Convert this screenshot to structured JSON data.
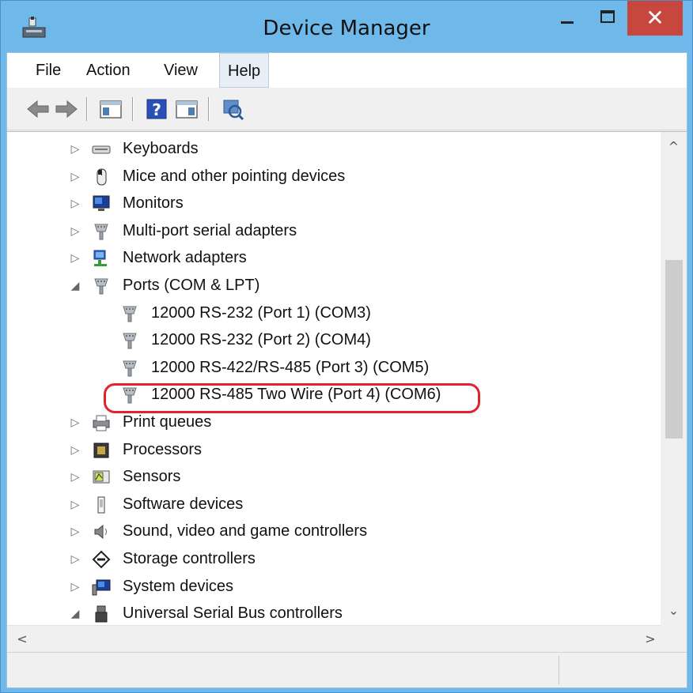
{
  "window": {
    "title": "Device Manager",
    "close_glyph": "✕"
  },
  "menu": {
    "items": [
      {
        "label": "File"
      },
      {
        "label": "Action"
      },
      {
        "label": "View"
      },
      {
        "label": "Help"
      }
    ]
  },
  "toolbar": {
    "buttons": [
      "back-arrow-icon",
      "forward-arrow-icon",
      "show-hide-tree-icon",
      "help-icon",
      "properties-icon",
      "scan-hardware-icon"
    ]
  },
  "tree": {
    "rows": [
      {
        "label": "Keyboards",
        "expander": "▷",
        "icon": "keyboard-icon"
      },
      {
        "label": "Mice and other pointing devices",
        "expander": "▷",
        "icon": "mouse-icon"
      },
      {
        "label": "Monitors",
        "expander": "▷",
        "icon": "monitor-icon"
      },
      {
        "label": "Multi-port serial adapters",
        "expander": "▷",
        "icon": "serial-port-icon"
      },
      {
        "label": "Network adapters",
        "expander": "▷",
        "icon": "network-icon"
      },
      {
        "label": "Ports (COM & LPT)",
        "expander": "◢",
        "icon": "serial-port-icon"
      },
      {
        "label": "12000 RS-232 (Port 1) (COM3)",
        "expander": "",
        "icon": "serial-port-icon"
      },
      {
        "label": "12000 RS-232 (Port 2) (COM4)",
        "expander": "",
        "icon": "serial-port-icon"
      },
      {
        "label": "12000 RS-422/RS-485 (Port 3) (COM5)",
        "expander": "",
        "icon": "serial-port-icon"
      },
      {
        "label": "12000 RS-485 Two Wire (Port 4) (COM6)",
        "expander": "",
        "icon": "serial-port-icon"
      },
      {
        "label": "Print queues",
        "expander": "▷",
        "icon": "printer-icon"
      },
      {
        "label": "Processors",
        "expander": "▷",
        "icon": "processor-icon"
      },
      {
        "label": "Sensors",
        "expander": "▷",
        "icon": "sensor-icon"
      },
      {
        "label": "Software devices",
        "expander": "▷",
        "icon": "software-device-icon"
      },
      {
        "label": "Sound, video and game controllers",
        "expander": "▷",
        "icon": "speaker-icon"
      },
      {
        "label": "Storage controllers",
        "expander": "▷",
        "icon": "storage-icon"
      },
      {
        "label": "System devices",
        "expander": "▷",
        "icon": "system-icon"
      },
      {
        "label": "Universal Serial Bus controllers",
        "expander": "◢",
        "icon": "usb-icon"
      }
    ]
  },
  "scrollbars": {
    "up": "^",
    "down": "⌄",
    "left": "<",
    "right": ">"
  }
}
